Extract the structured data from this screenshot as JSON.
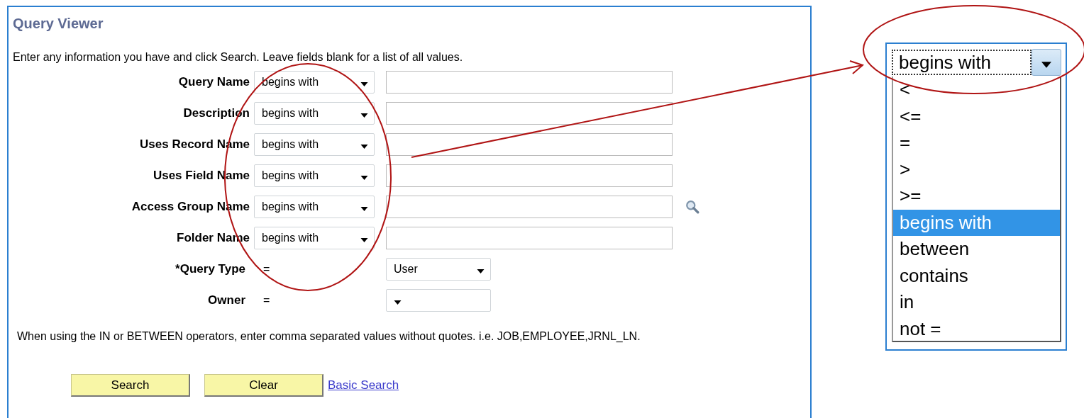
{
  "window": {
    "title": "Query Viewer"
  },
  "instructions": "Enter any information you have and click Search. Leave fields blank for a list of all values.",
  "criteria": [
    {
      "label": "Query Name",
      "operator": "begins with",
      "lookup": false
    },
    {
      "label": "Description",
      "operator": "begins with",
      "lookup": false
    },
    {
      "label": "Uses Record Name",
      "operator": "begins with",
      "lookup": false
    },
    {
      "label": "Uses Field Name",
      "operator": "begins with",
      "lookup": false
    },
    {
      "label": "Access Group Name",
      "operator": "begins with",
      "lookup": true
    },
    {
      "label": "Folder Name",
      "operator": "begins with",
      "lookup": false
    }
  ],
  "fixed_criteria": [
    {
      "label": "*Query Type",
      "operator": "=",
      "value": "User"
    },
    {
      "label": "Owner",
      "operator": "="
    }
  ],
  "note": "When using the IN or BETWEEN operators, enter comma separated values without quotes. i.e. JOB,EMPLOYEE,JRNL_LN.",
  "buttons": [
    {
      "label": "Search"
    },
    {
      "label": "Clear"
    }
  ],
  "link": "Basic Search",
  "dropdown_popup": {
    "value": "begins with",
    "options": [
      {
        "label": "<",
        "selected": false
      },
      {
        "label": "<=",
        "selected": false
      },
      {
        "label": "=",
        "selected": false
      },
      {
        "label": ">",
        "selected": false
      },
      {
        "label": ">=",
        "selected": false
      },
      {
        "label": "begins with",
        "selected": true
      },
      {
        "label": "between",
        "selected": false
      },
      {
        "label": "contains",
        "selected": false
      },
      {
        "label": "in",
        "selected": false
      },
      {
        "label": "not =",
        "selected": false
      }
    ]
  }
}
